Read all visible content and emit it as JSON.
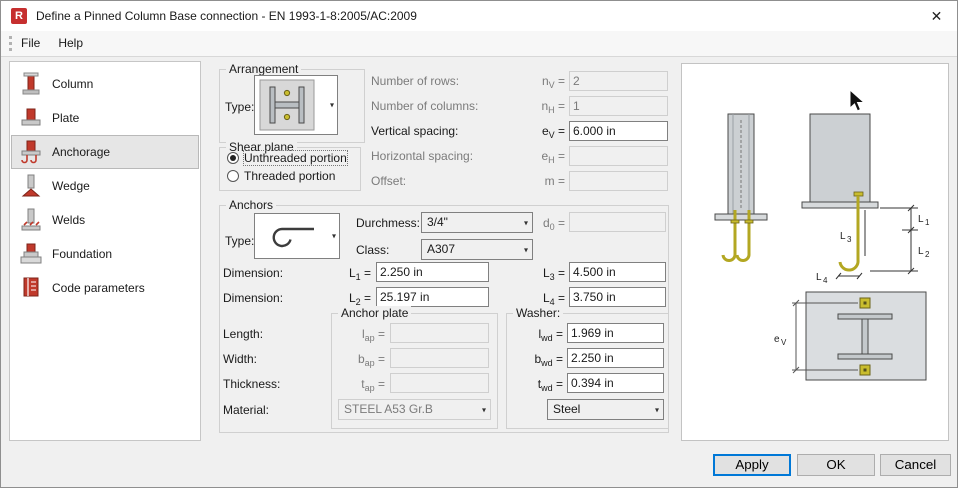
{
  "window": {
    "title": "Define a Pinned Column Base connection - EN 1993-1-8:2005/AC:2009",
    "close_glyph": "✕",
    "app_letter": "R"
  },
  "menu": {
    "items": [
      {
        "label": "File"
      },
      {
        "label": "Help"
      }
    ]
  },
  "sidebar": {
    "selected_index": 2,
    "items": [
      {
        "label": "Column"
      },
      {
        "label": "Plate"
      },
      {
        "label": "Anchorage"
      },
      {
        "label": "Wedge"
      },
      {
        "label": "Welds"
      },
      {
        "label": "Foundation"
      },
      {
        "label": "Code parameters"
      }
    ]
  },
  "ui": {
    "equals": "=",
    "chevron": "▾"
  },
  "arrangement": {
    "title": "Arrangement",
    "type_label": "Type:",
    "fields": {
      "rows": {
        "label": "Number of rows:",
        "sym": "n",
        "sub": "V",
        "value": "2"
      },
      "cols": {
        "label": "Number of columns:",
        "sym": "n",
        "sub": "H",
        "value": "1"
      },
      "vspacing": {
        "label": "Vertical spacing:",
        "sym": "e",
        "sub": "V",
        "value": "6.000 in"
      },
      "hspacing": {
        "label": "Horizontal spacing:",
        "sym": "e",
        "sub": "H",
        "value": ""
      },
      "offset": {
        "label": "Offset:",
        "sym": "m",
        "sub": "",
        "value": ""
      }
    }
  },
  "shear_plane": {
    "title": "Shear plane",
    "selected_index": 0,
    "options": [
      {
        "label": "Unthreaded portion"
      },
      {
        "label": "Threaded portion"
      }
    ]
  },
  "anchors": {
    "title": "Anchors",
    "type_label": "Type:",
    "diameter": {
      "label": "Durchmess:",
      "value": "3/4\""
    },
    "d0": {
      "sym": "d",
      "sub": "0",
      "value": ""
    },
    "class": {
      "label": "Class:",
      "value": "A307"
    },
    "dimension_label_1": "Dimension:",
    "dimension_label_2": "Dimension:",
    "L1": {
      "sym": "L",
      "sub": "1",
      "value": "2.250 in"
    },
    "L2": {
      "sym": "L",
      "sub": "2",
      "value": "25.197 in"
    },
    "L3": {
      "sym": "L",
      "sub": "3",
      "value": "4.500 in"
    },
    "L4": {
      "sym": "L",
      "sub": "4",
      "value": "3.750 in"
    }
  },
  "anchor_plate": {
    "title": "Anchor plate",
    "length_label": "Length:",
    "width_label": "Width:",
    "thickness_label": "Thickness:",
    "material_label": "Material:",
    "lap": {
      "sym": "l",
      "sub": "ap",
      "value": ""
    },
    "bap": {
      "sym": "b",
      "sub": "ap",
      "value": ""
    },
    "tap": {
      "sym": "t",
      "sub": "ap",
      "value": ""
    },
    "material_value": "STEEL A53 Gr.B"
  },
  "washer": {
    "title": "Washer:",
    "lwd": {
      "sym": "l",
      "sub": "wd",
      "value": "1.969 in"
    },
    "bwd": {
      "sym": "b",
      "sub": "wd",
      "value": "2.250 in"
    },
    "twd": {
      "sym": "t",
      "sub": "wd",
      "value": "0.394 in"
    },
    "material_value": "Steel"
  },
  "preview": {
    "dims": {
      "L1": {
        "sym": "L",
        "sub": "1"
      },
      "L2": {
        "sym": "L",
        "sub": "2"
      },
      "L3": {
        "sym": "L",
        "sub": "3"
      },
      "L4": {
        "sym": "L",
        "sub": "4"
      },
      "eV": {
        "sym": "e",
        "sub": "V"
      }
    }
  },
  "footer": {
    "apply": "Apply",
    "ok": "OK",
    "cancel": "Cancel"
  },
  "colors": {
    "accent": "#0078d7",
    "anchor_yellow": "#c9bd2e",
    "steel_gray": "#ccd0d3"
  }
}
